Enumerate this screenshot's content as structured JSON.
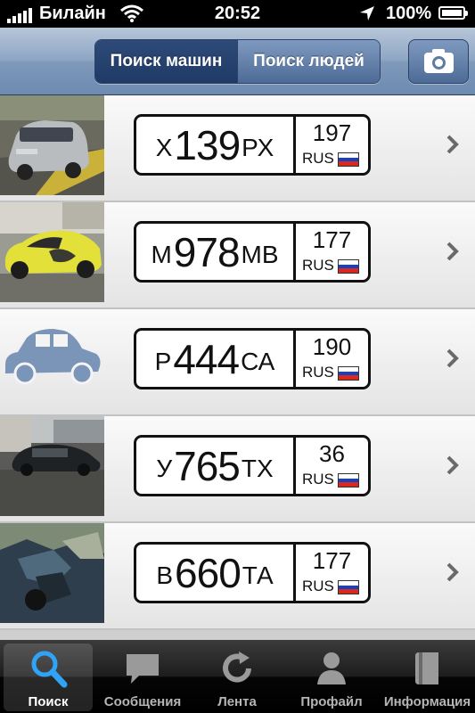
{
  "status_bar": {
    "carrier": "Билайн",
    "time": "20:52",
    "battery": "100%"
  },
  "nav": {
    "segments": [
      "Поиск машин",
      "Поиск людей"
    ],
    "active_segment": 0,
    "camera_icon": "camera-icon"
  },
  "plates": [
    {
      "letter1": "Х",
      "digits": "139",
      "letters2": "РХ",
      "region": "197",
      "country": "RUS",
      "thumb": "silver-hatchback-photo"
    },
    {
      "letter1": "М",
      "digits": "978",
      "letters2": "МВ",
      "region": "177",
      "country": "RUS",
      "thumb": "yellow-car-photo"
    },
    {
      "letter1": "Р",
      "digits": "444",
      "letters2": "СА",
      "region": "190",
      "country": "RUS",
      "thumb": "car-placeholder-icon"
    },
    {
      "letter1": "У",
      "digits": "765",
      "letters2": "ТХ",
      "region": "36",
      "country": "RUS",
      "thumb": "black-sedan-photo"
    },
    {
      "letter1": "В",
      "digits": "660",
      "letters2": "ТА",
      "region": "177",
      "country": "RUS",
      "thumb": "crashed-car-photo"
    }
  ],
  "tabs": [
    {
      "label": "Поиск",
      "icon": "search-icon",
      "active": true
    },
    {
      "label": "Сообщения",
      "icon": "chat-bubble-icon",
      "active": false
    },
    {
      "label": "Лента",
      "icon": "refresh-icon",
      "active": false
    },
    {
      "label": "Профайл",
      "icon": "person-icon",
      "active": false
    },
    {
      "label": "Информация",
      "icon": "book-icon",
      "active": false
    }
  ],
  "colors": {
    "flag_white": "#ffffff",
    "flag_blue": "#1c3fbf",
    "flag_red": "#d52b1e",
    "nav_active": "#1f3a66"
  }
}
